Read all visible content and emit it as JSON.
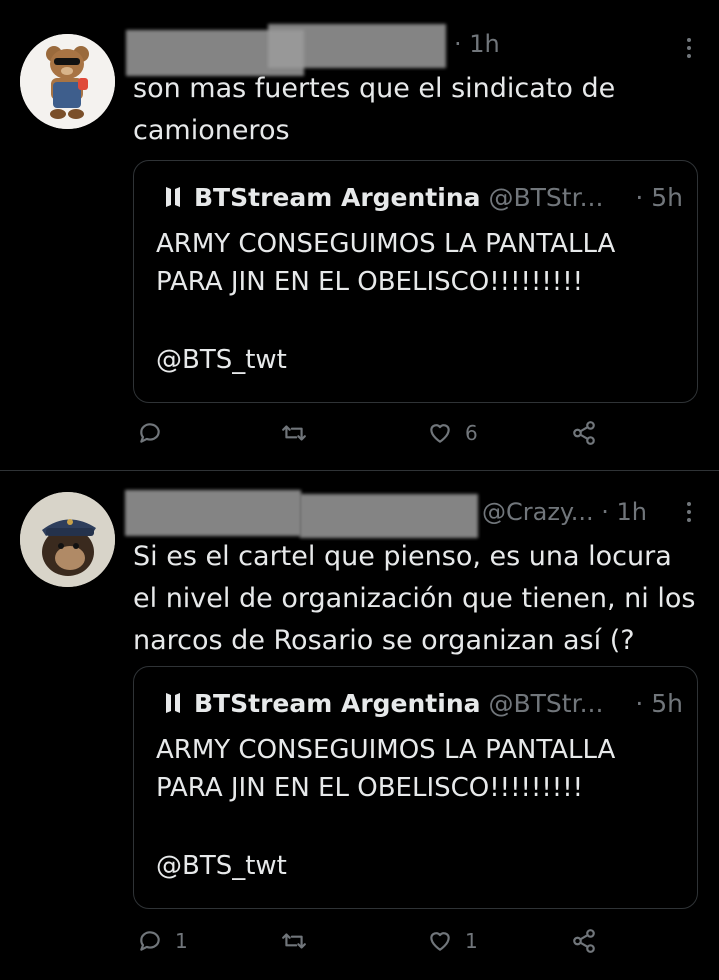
{
  "tweets": [
    {
      "time": "· 1h",
      "text": "son mas fuertes que el sindicato de\ncamioneros",
      "quote": {
        "name": "BTStream Argentina",
        "handle": "@BTStr...",
        "time": "· 5h",
        "body": "ARMY CONSEGUIMOS LA PANTALLA\nPARA JIN EN EL OBELISCO!!!!!!!!!",
        "mention": "@BTS_twt"
      },
      "actions": {
        "replies": "",
        "retweets": "",
        "likes": "6"
      },
      "avatar_icon": "teddy-bear-avatar"
    },
    {
      "handle": "@Crazy...",
      "time": "· 1h",
      "text": "Si es el cartel que pienso, es una locura\nel nivel de organización que tienen, ni los\nnarcos de Rosario se organizan así (?",
      "quote": {
        "name": "BTStream Argentina",
        "handle": "@BTStr...",
        "time": "· 5h",
        "body": "ARMY CONSEGUIMOS LA PANTALLA\nPARA JIN EN EL OBELISCO!!!!!!!!!",
        "mention": "@BTS_twt"
      },
      "actions": {
        "replies": "1",
        "retweets": "",
        "likes": "1"
      },
      "avatar_icon": "ape-avatar"
    }
  ],
  "colors": {
    "background": "#000000",
    "text": "#e7e9ea",
    "muted": "#71767b",
    "border": "#2f3336"
  }
}
